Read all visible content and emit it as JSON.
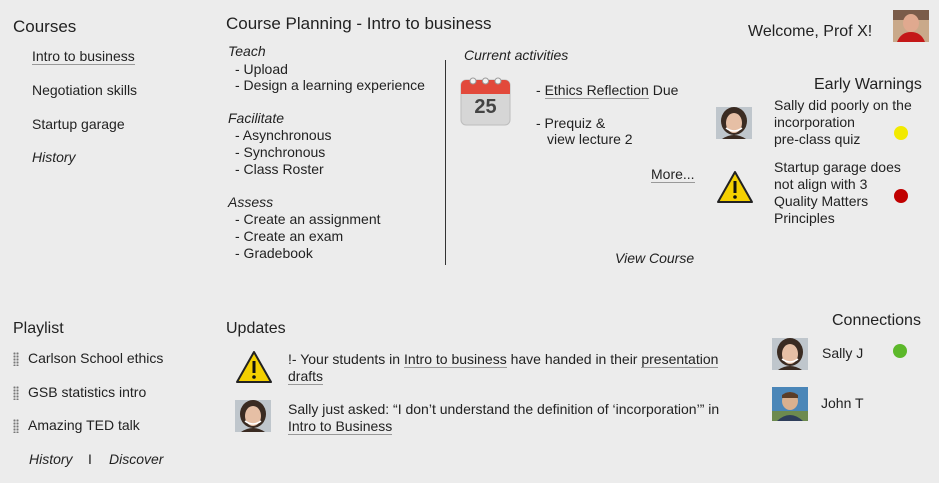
{
  "courses": {
    "title": "Courses",
    "items": [
      "Intro to business",
      "Negotiation skills",
      "Startup garage"
    ],
    "history": "History"
  },
  "planning": {
    "title": "Course Planning - Intro to business",
    "teach": {
      "heading": "Teach",
      "items": [
        "- Upload",
        "- Design a learning experience"
      ]
    },
    "facilitate": {
      "heading": "Facilitate",
      "items": [
        "- Asynchronous",
        "- Synchronous",
        "- Class Roster"
      ]
    },
    "assess": {
      "heading": "Assess",
      "items": [
        "- Create an assignment",
        "- Create an exam",
        "- Gradebook"
      ]
    }
  },
  "activities": {
    "title": "Current activities",
    "calendar_day": "25",
    "item1_prefix": "- ",
    "item1_link": "Ethics Reflection",
    "item1_suffix": " Due",
    "item2_line1": "- Prequiz &",
    "item2_line2": "view lecture 2",
    "more": "More...",
    "view_course": "View Course"
  },
  "header": {
    "welcome": "Welcome, Prof X!"
  },
  "warnings": {
    "title": "Early Warnings",
    "items": [
      {
        "text": [
          "Sally did poorly on the",
          "incorporation",
          "pre-class quiz"
        ],
        "color": "#f2ea00",
        "icon": "student-avatar"
      },
      {
        "text": [
          "Startup garage does",
          "not align with 3",
          "Quality Matters",
          "Principles"
        ],
        "color": "#c00000",
        "icon": "warning-icon"
      }
    ]
  },
  "playlist": {
    "title": "Playlist",
    "items": [
      "Carlson School ethics",
      "GSB statistics intro",
      "Amazing TED talk"
    ],
    "history": "History",
    "separator": "I",
    "discover": "Discover"
  },
  "updates": {
    "title": "Updates",
    "u1": {
      "p1": "!- Your students in ",
      "link1": "Intro to business",
      "p2": " have handed in their ",
      "link2a": "presentation",
      "link2b": "drafts"
    },
    "u2": {
      "line1": "Sally just asked: “I don’t understand the definition of ‘incorporation’” in",
      "link": "Intro to Business"
    }
  },
  "connections": {
    "title": "Connections",
    "items": [
      {
        "name": "Sally J",
        "status_color": "#5cb82a"
      },
      {
        "name": "John T"
      }
    ]
  }
}
